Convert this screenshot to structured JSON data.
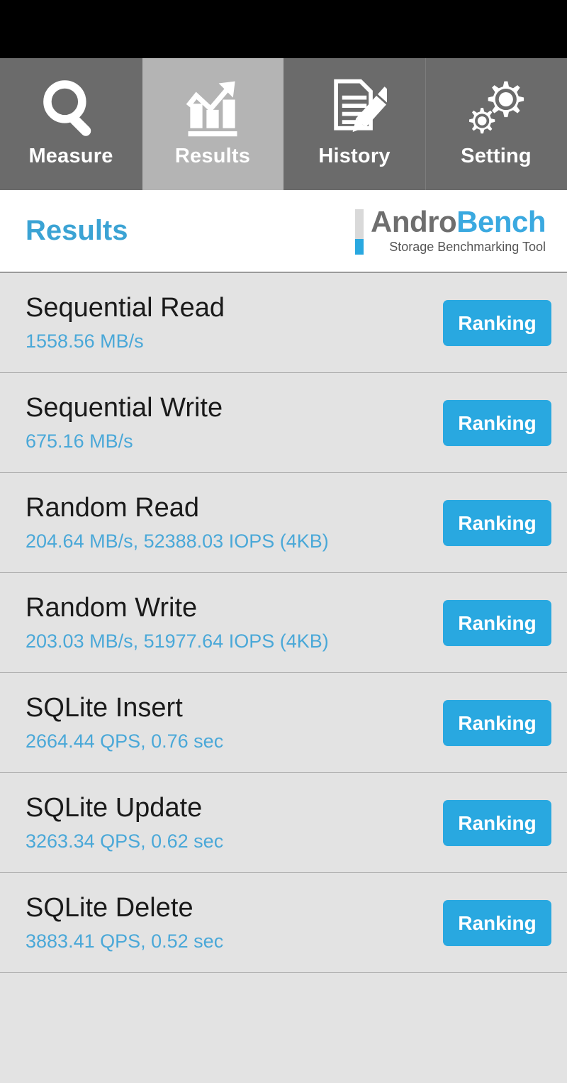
{
  "colors": {
    "accent_blue": "#29a8e0",
    "title_blue": "#3ba3d4",
    "value_blue": "#4aa8d8",
    "tab_inactive": "#6b6b6b",
    "tab_active": "#b4b4b4",
    "list_bg": "#e3e3e3",
    "status_bar": "#000000",
    "logo_gray": "#6e6e6e"
  },
  "tabs": [
    {
      "label": "Measure",
      "icon": "search-icon",
      "active": false
    },
    {
      "label": "Results",
      "icon": "chart-icon",
      "active": true
    },
    {
      "label": "History",
      "icon": "document-pencil-icon",
      "active": false
    },
    {
      "label": "Setting",
      "icon": "gears-icon",
      "active": false
    }
  ],
  "header": {
    "title": "Results",
    "logo": {
      "primary": "Andro",
      "secondary": "Bench",
      "tagline": "Storage Benchmarking Tool"
    }
  },
  "results": {
    "button_label": "Ranking",
    "rows": [
      {
        "name": "Sequential Read",
        "value": "1558.56 MB/s"
      },
      {
        "name": "Sequential Write",
        "value": "675.16 MB/s"
      },
      {
        "name": "Random Read",
        "value": "204.64 MB/s, 52388.03 IOPS (4KB)"
      },
      {
        "name": "Random Write",
        "value": "203.03 MB/s, 51977.64 IOPS (4KB)"
      },
      {
        "name": "SQLite Insert",
        "value": "2664.44 QPS, 0.76 sec"
      },
      {
        "name": "SQLite Update",
        "value": "3263.34 QPS, 0.62 sec"
      },
      {
        "name": "SQLite Delete",
        "value": "3883.41 QPS, 0.52 sec"
      }
    ]
  }
}
